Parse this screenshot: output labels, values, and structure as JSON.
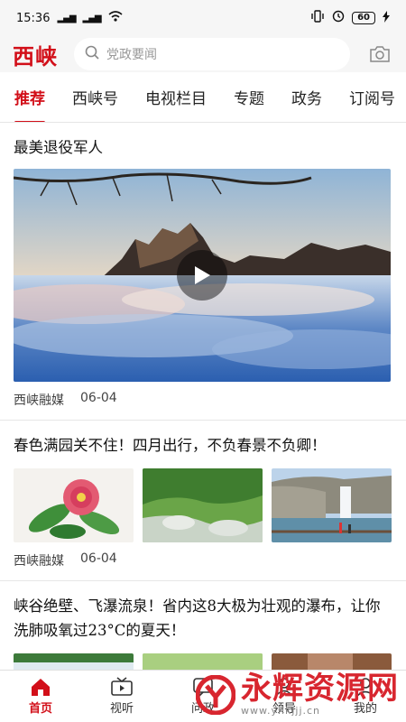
{
  "status_bar": {
    "time": "15:36",
    "signal_left": "4G",
    "signal_right": "4G",
    "battery": "60"
  },
  "header": {
    "logo": "西峡",
    "search_placeholder": "党政要闻"
  },
  "tabs": [
    {
      "label": "推荐",
      "active": true
    },
    {
      "label": "西峡号"
    },
    {
      "label": "电视栏目"
    },
    {
      "label": "专题"
    },
    {
      "label": "政务"
    },
    {
      "label": "订阅号"
    }
  ],
  "articles": [
    {
      "title": "最美退役军人",
      "source": "西峡融媒",
      "date": "06-04",
      "type": "video"
    },
    {
      "title": "春色满园关不住！四月出行，不负春景不负卿！",
      "source": "西峡融媒",
      "date": "06-04",
      "type": "three-images"
    },
    {
      "title": "峡谷绝壁、飞瀑流泉！省内这8大极为壮观的瀑布，让你洗肺吸氧过23°C的夏天！",
      "type": "three-images"
    }
  ],
  "bottom_nav": [
    {
      "label": "首页",
      "icon": "home-icon",
      "active": true
    },
    {
      "label": "视听",
      "icon": "tv-icon"
    },
    {
      "label": "问政",
      "icon": "question-icon"
    },
    {
      "label": "领导",
      "icon": "leader-icon"
    },
    {
      "label": "我的",
      "icon": "user-icon"
    }
  ],
  "watermark": {
    "text": "永辉资源网",
    "url": "www.yhkjjj.cn"
  },
  "colors": {
    "brand": "#d20f19",
    "divider": "#e5e5e5"
  }
}
